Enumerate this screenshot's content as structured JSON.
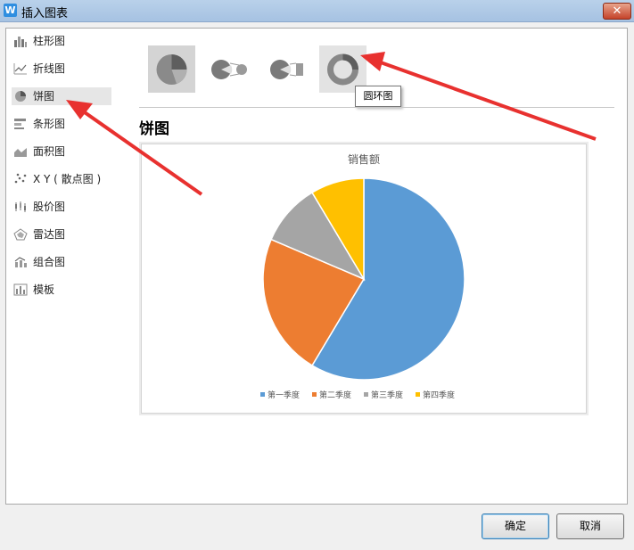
{
  "window": {
    "app_icon": "W",
    "title": "插入图表",
    "close_label": "✕"
  },
  "sidebar": {
    "items": [
      {
        "label": "柱形图",
        "icon": "bar-chart-icon"
      },
      {
        "label": "折线图",
        "icon": "line-chart-icon"
      },
      {
        "label": "饼图",
        "icon": "pie-chart-icon",
        "selected": true
      },
      {
        "label": "条形图",
        "icon": "horizontal-bar-icon"
      },
      {
        "label": "面积图",
        "icon": "area-chart-icon"
      },
      {
        "label": "X Y ( 散点图 )",
        "icon": "scatter-chart-icon"
      },
      {
        "label": "股价图",
        "icon": "stock-chart-icon"
      },
      {
        "label": "雷达图",
        "icon": "radar-chart-icon"
      },
      {
        "label": "组合图",
        "icon": "combo-chart-icon"
      },
      {
        "label": "模板",
        "icon": "template-icon"
      }
    ]
  },
  "subtypes": {
    "items": [
      "pie-icon",
      "pie-of-pie-icon",
      "bar-of-pie-icon",
      "doughnut-icon"
    ],
    "selected": 0,
    "hovered": 3,
    "tooltip": "圆环图"
  },
  "main": {
    "section_title": "饼图"
  },
  "chart_data": {
    "type": "pie",
    "title": "销售额",
    "categories": [
      "第一季度",
      "第二季度",
      "第三季度",
      "第四季度"
    ],
    "values": [
      8.2,
      3.2,
      1.4,
      1.2
    ],
    "colors": [
      "#5b9bd5",
      "#ed7d31",
      "#a5a5a5",
      "#ffc000"
    ],
    "legend": "bottom"
  },
  "buttons": {
    "ok": "确定",
    "cancel": "取消"
  },
  "colors": {
    "annotation_arrow": "#e8312f",
    "titlebar": "#b9d1ea"
  }
}
